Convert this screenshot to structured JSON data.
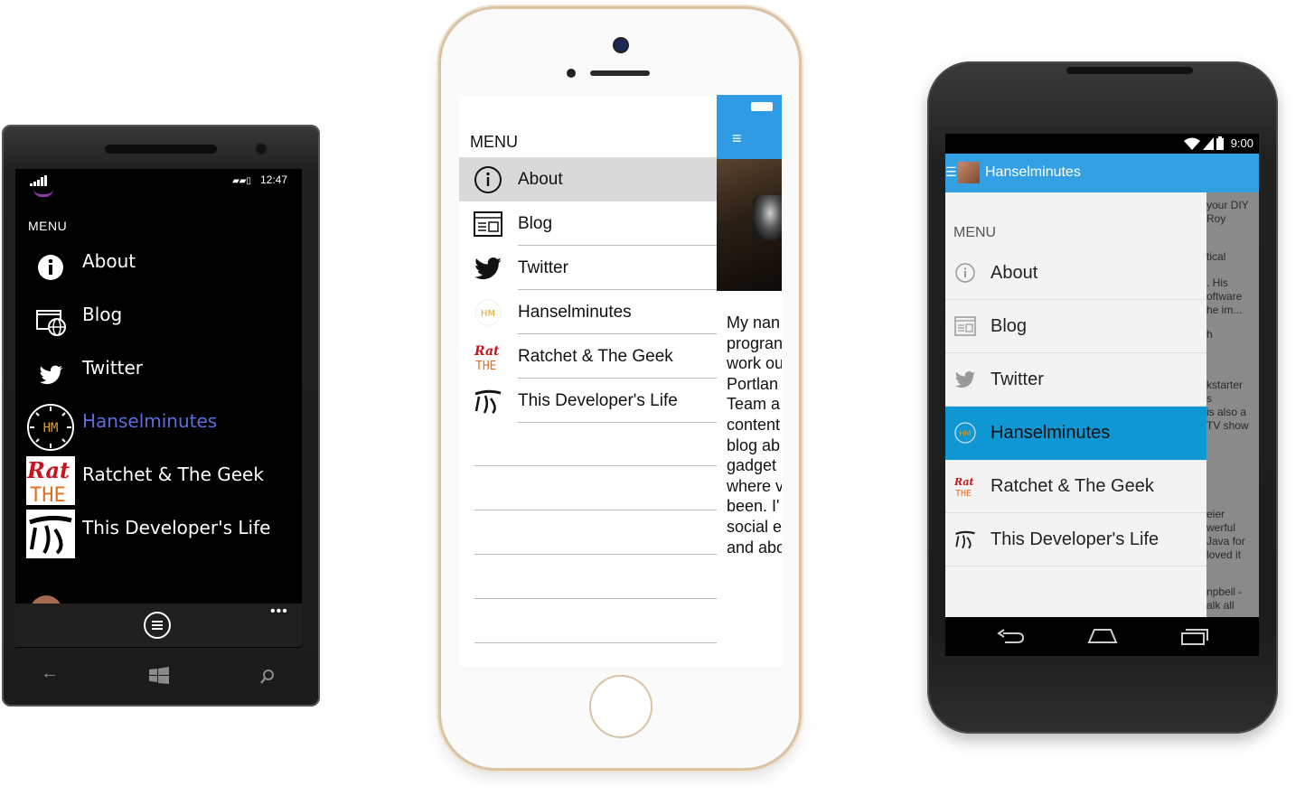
{
  "windows_phone": {
    "status_time": "12:47",
    "menu_label": "MENU",
    "items": [
      {
        "label": "About",
        "icon": "info-icon"
      },
      {
        "label": "Blog",
        "icon": "browser-globe-icon"
      },
      {
        "label": "Twitter",
        "icon": "twitter-bird-icon"
      },
      {
        "label": "Hanselminutes",
        "icon": "hanselminutes-logo",
        "selected": true
      },
      {
        "label": "Ratchet & The Geek",
        "icon": "ratchet-logo"
      },
      {
        "label": "This Developer's Life",
        "icon": "developers-life-logo"
      }
    ],
    "more": "•••",
    "selected_color": "#5b6ee0"
  },
  "iphone": {
    "menu_label": "MENU",
    "items": [
      {
        "label": "About",
        "icon": "info-icon",
        "selected": true
      },
      {
        "label": "Blog",
        "icon": "blog-window-icon"
      },
      {
        "label": "Twitter",
        "icon": "twitter-bird-icon"
      },
      {
        "label": "Hanselminutes",
        "icon": "hanselminutes-logo"
      },
      {
        "label": "Ratchet & The Geek",
        "icon": "ratchet-logo"
      },
      {
        "label": "This Developer's Life",
        "icon": "developers-life-logo"
      }
    ],
    "hamburger": "≡",
    "detail_text": "My nan\nprogran\nwork ou\nPortlan\nTeam a\ncontent\nblog ab\ngadget\nwhere v\nbeen. I'\nsocial e\nand abo",
    "accent": "#2f9be5"
  },
  "android": {
    "status_time": "9:00",
    "app_title": "Hanselminutes",
    "menu_label": "MENU",
    "items": [
      {
        "label": "About",
        "icon": "info-icon"
      },
      {
        "label": "Blog",
        "icon": "blog-window-icon"
      },
      {
        "label": "Twitter",
        "icon": "twitter-bird-icon"
      },
      {
        "label": "Hanselminutes",
        "icon": "hanselminutes-logo",
        "selected": true
      },
      {
        "label": "Ratchet & The Geek",
        "icon": "ratchet-logo"
      },
      {
        "label": "This Developer's Life",
        "icon": "developers-life-logo"
      }
    ],
    "background_snippets": [
      "your DIY",
      "Roy",
      "tical",
      ". His",
      "oftware",
      "he im...",
      "h",
      "kstarter",
      "s",
      "is also a",
      "TV show",
      "eier",
      "werful",
      "Java for",
      "loved it",
      "npbell -",
      "alk all"
    ],
    "accent": "#33a0e4",
    "selected_color": "#0f97d4"
  }
}
